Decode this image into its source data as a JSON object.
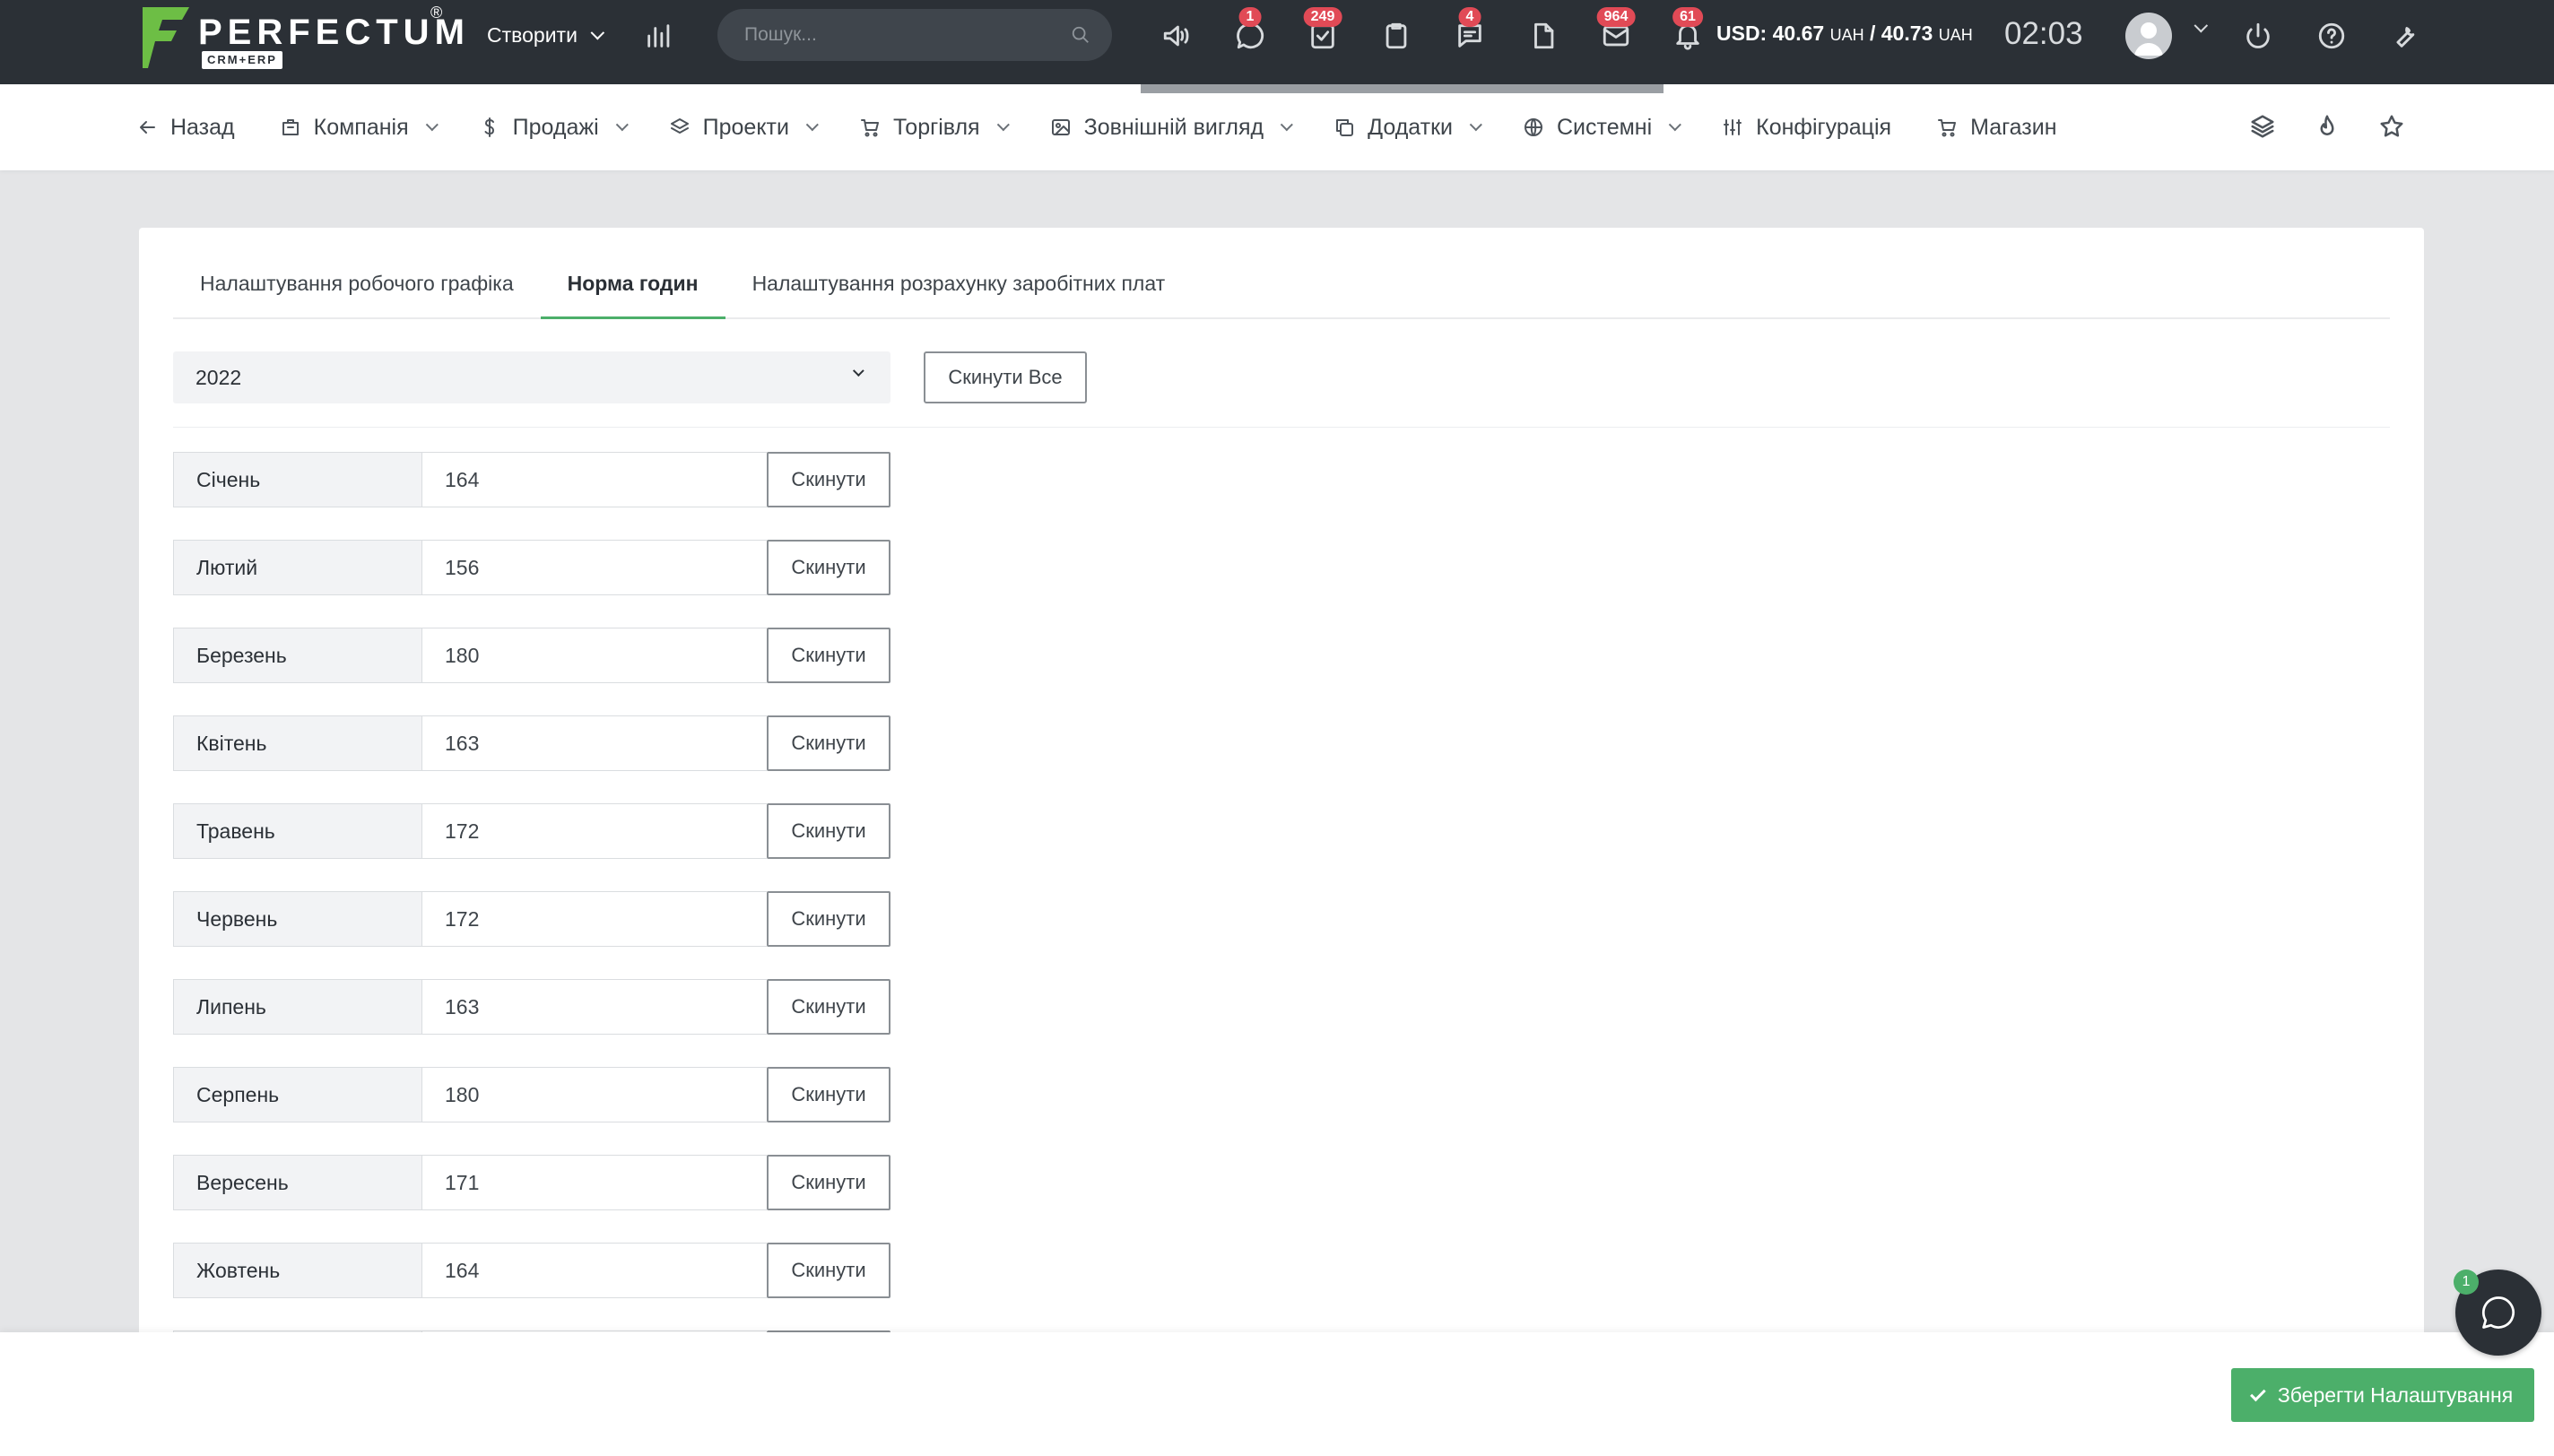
{
  "app": {
    "logo_text": "PERFECTUM",
    "logo_sub": "CRM+ERP",
    "logo_reg": "®"
  },
  "topbar": {
    "create_label": "Створити",
    "search_placeholder": "Пошук...",
    "badges": {
      "chat": "1",
      "tasks": "249",
      "messages": "4",
      "mail": "964",
      "notifications": "61"
    },
    "currency_prefix": "USD: ",
    "currency_buy": "40.67",
    "currency_sell": "40.73",
    "currency_unit": "UAH",
    "currency_separator": " / ",
    "clock": "02:03"
  },
  "nav": {
    "back": "Назад",
    "company": "Компанія",
    "sales": "Продажі",
    "projects": "Проекти",
    "trade": "Торгівля",
    "appearance": "Зовнішній вигляд",
    "addons": "Додатки",
    "system": "Системні",
    "configuration": "Конфігурація",
    "shop": "Магазин"
  },
  "tabs": [
    {
      "label": "Налаштування робочого графіка",
      "active": false
    },
    {
      "label": "Норма годин",
      "active": true
    },
    {
      "label": "Налаштування розрахунку заробітних плат",
      "active": false
    }
  ],
  "year_select": {
    "value": "2022"
  },
  "reset_all_label": "Скинути Все",
  "reset_label": "Скинути",
  "months": [
    {
      "name": "Січень",
      "hours": "164"
    },
    {
      "name": "Лютий",
      "hours": "156"
    },
    {
      "name": "Березень",
      "hours": "180"
    },
    {
      "name": "Квітень",
      "hours": "163"
    },
    {
      "name": "Травень",
      "hours": "172"
    },
    {
      "name": "Червень",
      "hours": "172"
    },
    {
      "name": "Липень",
      "hours": "163"
    },
    {
      "name": "Серпень",
      "hours": "180"
    },
    {
      "name": "Вересень",
      "hours": "171"
    },
    {
      "name": "Жовтень",
      "hours": "164"
    }
  ],
  "save_label": "Зберегти Налаштування",
  "chat_widget_badge": "1",
  "colors": {
    "topbar_bg": "#2b3036",
    "accent_green": "#4caf6a",
    "badge_red": "#e14a56",
    "page_bg": "#e4e5e7"
  }
}
